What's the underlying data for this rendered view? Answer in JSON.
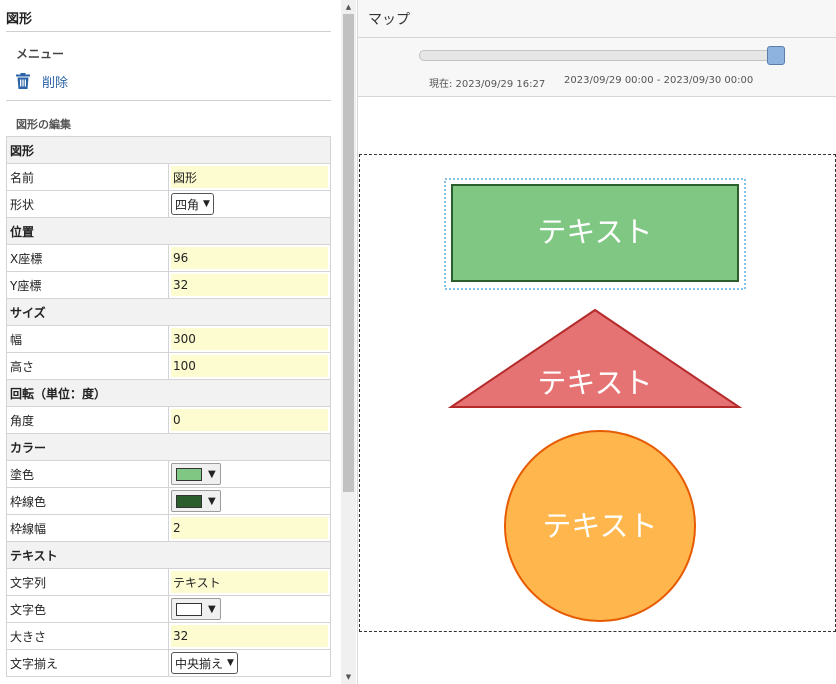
{
  "left_panel": {
    "title": "図形",
    "menu_label": "メニュー",
    "delete_label": "削除",
    "edit_label": "図形の編集",
    "sections": {
      "shape": "図形",
      "position": "位置",
      "size": "サイズ",
      "rotation": "回転（単位：度）",
      "color": "カラー",
      "text": "テキスト"
    },
    "fields": {
      "name": {
        "label": "名前",
        "value": "図形"
      },
      "shape_type": {
        "label": "形状",
        "value": "四角"
      },
      "x": {
        "label": "X座標",
        "value": "96"
      },
      "y": {
        "label": "Y座標",
        "value": "32"
      },
      "width": {
        "label": "幅",
        "value": "300"
      },
      "height": {
        "label": "高さ",
        "value": "100"
      },
      "angle": {
        "label": "角度",
        "value": "0"
      },
      "fill_color": {
        "label": "塗色",
        "color": "#80c783"
      },
      "stroke_color": {
        "label": "枠線色",
        "color": "#2a5e2c"
      },
      "stroke_width": {
        "label": "枠線幅",
        "value": "2"
      },
      "text_string": {
        "label": "文字列",
        "value": "テキスト"
      },
      "text_color": {
        "label": "文字色",
        "color": "#ffffff"
      },
      "font_size": {
        "label": "大きさ",
        "value": "32"
      },
      "text_align": {
        "label": "文字揃え",
        "value": "中央揃え"
      }
    }
  },
  "map": {
    "title": "マップ",
    "slider_fraction": 0.98,
    "current_time": "現在: 2023/09/29 16:27",
    "time_range": "2023/09/29 00:00 - 2023/09/30 00:00",
    "shapes": [
      {
        "type": "rect",
        "text": "テキスト",
        "fill": "#80c783",
        "stroke": "#2a5e2c",
        "selected": true
      },
      {
        "type": "triangle",
        "text": "テキスト",
        "fill": "#e57373",
        "stroke": "#b52a2a",
        "selected": false
      },
      {
        "type": "circle",
        "text": "テキスト",
        "fill": "#ffb74d",
        "stroke": "#e65a00",
        "selected": false
      }
    ]
  },
  "colors": {
    "accent": "#2a63a8",
    "input_bg": "#fdfbd0"
  },
  "icons": {
    "delete": "trash-icon"
  }
}
